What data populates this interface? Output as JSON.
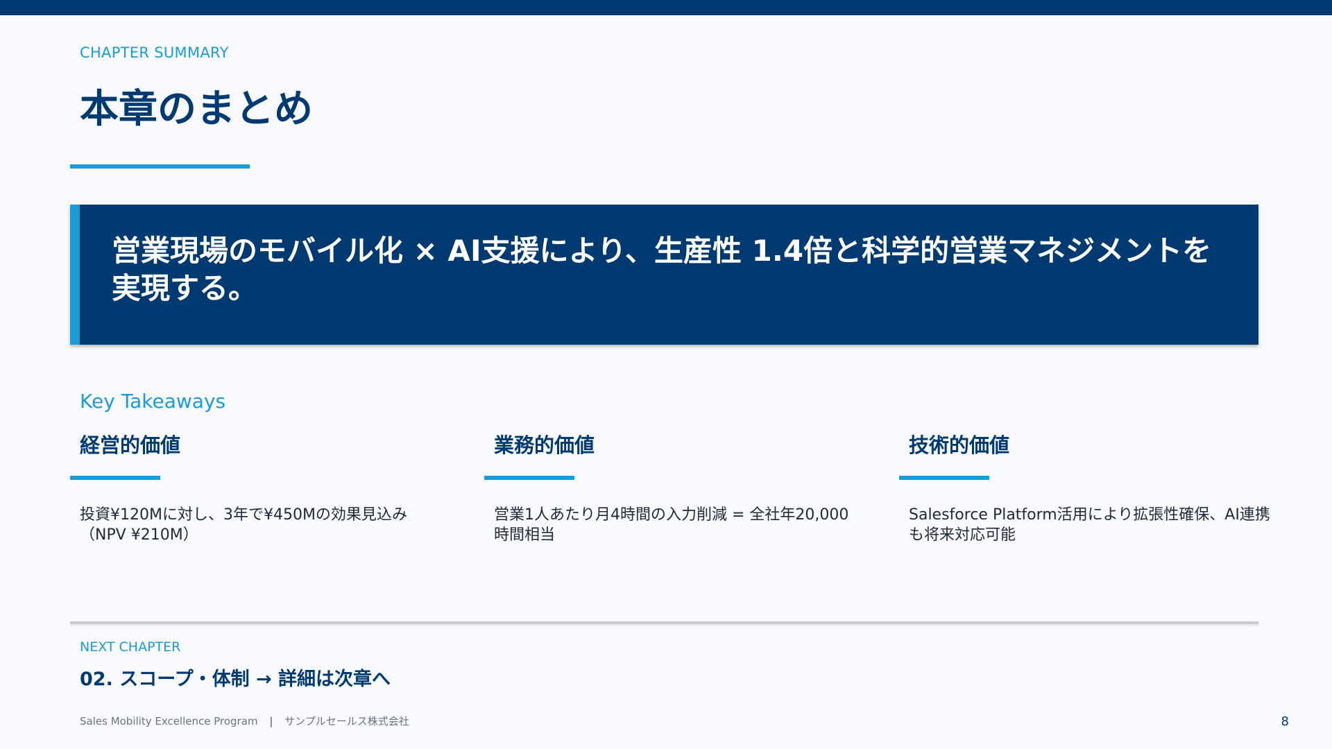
{
  "header": {
    "eyebrow": "CHAPTER SUMMARY",
    "title": "本章のまとめ"
  },
  "banner": {
    "text": "営業現場のモバイル化 × AI支援により、生産性 1.4倍と科学的営業マネジメントを実現する。"
  },
  "takeaways": {
    "label": "Key Takeaways",
    "items": [
      {
        "title": "経営的価値",
        "body": "投資¥120Mに対し、3年で¥450Mの効果見込み（NPV ¥210M）"
      },
      {
        "title": "業務的価値",
        "body": "営業1人あたり月4時間の入力削減 = 全社年20,000時間相当"
      },
      {
        "title": "技術的価値",
        "body": "Salesforce Platform活用により拡張性確保、AI連携も将来対応可能"
      }
    ]
  },
  "next_chapter": {
    "label": "NEXT CHAPTER",
    "title": "02. スコープ・体制 → 詳細は次章へ"
  },
  "footer": {
    "program": "Sales Mobility Excellence Program",
    "separator": "|",
    "company": "サンプルセールス株式会社",
    "page_number": "8"
  },
  "colors": {
    "navy": "#003a70",
    "accent": "#1a9bd7",
    "background": "#f7f9fc"
  }
}
